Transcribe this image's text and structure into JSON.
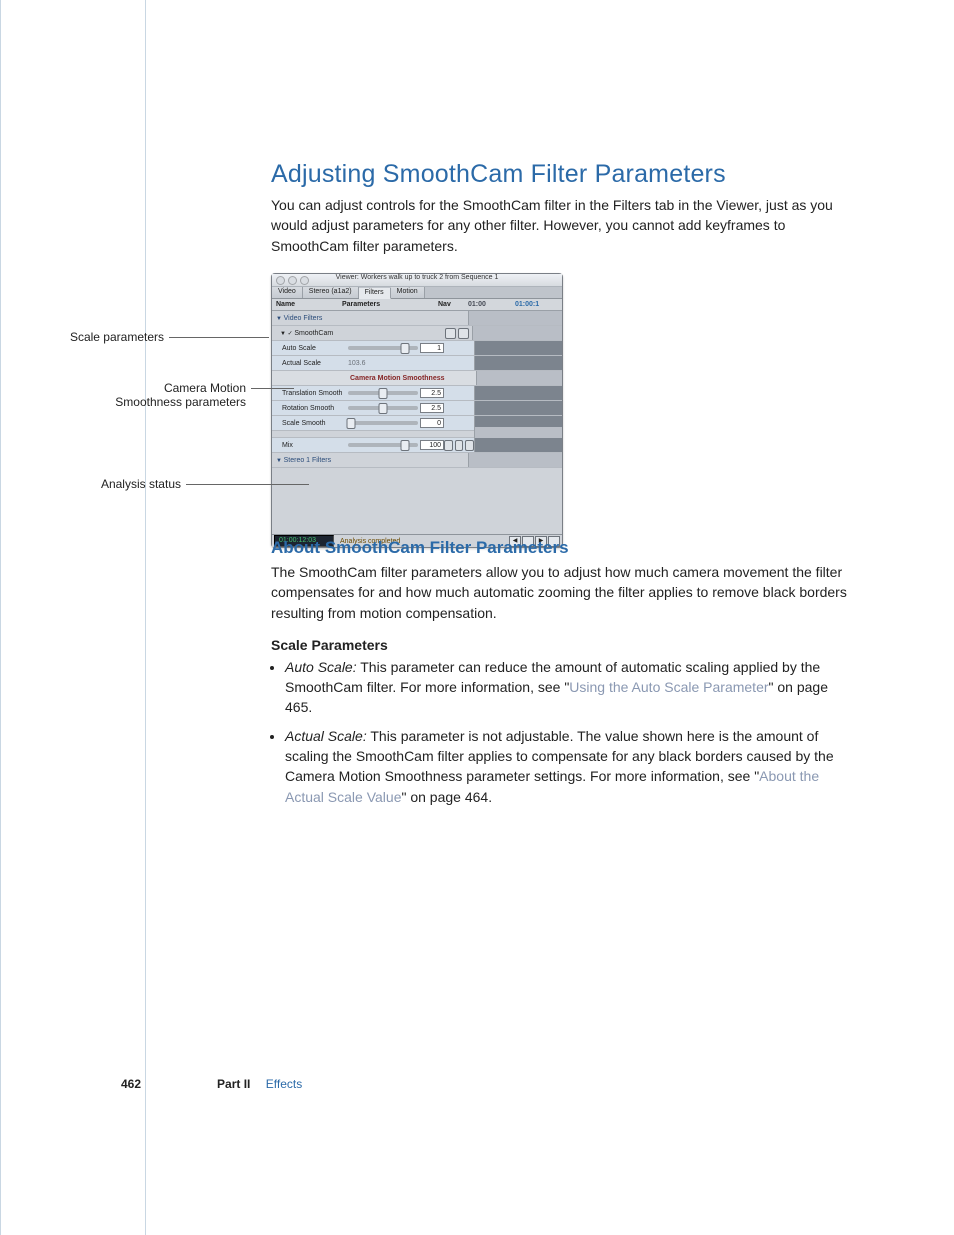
{
  "headings": {
    "h1": "Adjusting SmoothCam Filter Parameters",
    "h2": "About SmoothCam Filter Parameters",
    "h3": "Scale Parameters"
  },
  "paras": {
    "intro": "You can adjust controls for the SmoothCam filter in the Filters tab in the Viewer, just as you would adjust parameters for any other filter. However, you cannot add keyframes to SmoothCam filter parameters.",
    "about": "The SmoothCam filter parameters allow you to adjust how much camera movement the filter compensates for and how much automatic zooming the filter applies to remove black borders resulting from motion compensation."
  },
  "bullets": {
    "autoScale": {
      "termLabel": "Auto Scale:",
      "preLink": " This parameter can reduce the amount of automatic scaling applied by the SmoothCam filter. For more information, see \"",
      "link": "Using the Auto Scale Parameter",
      "postLink": "\" on page 465."
    },
    "actualScale": {
      "termLabel": "Actual Scale:",
      "preLink": " This parameter is not adjustable. The value shown here is the amount of scaling the SmoothCam filter applies to compensate for any black borders caused by the Camera Motion Smoothness parameter settings. For more information, see \"",
      "link": "About the Actual Scale Value",
      "postLink": "\" on page 464."
    }
  },
  "callouts": {
    "scale": "Scale parameters",
    "camera_l1": "Camera Motion",
    "camera_l2": "Smoothness parameters",
    "analysis": "Analysis status"
  },
  "viewer": {
    "title": "Viewer: Workers walk up to truck 2 from Sequence 1",
    "tabs": [
      "Video",
      "Stereo (a1a2)",
      "Filters",
      "Motion"
    ],
    "activeTab": 2,
    "columns": {
      "name": "Name",
      "parameters": "Parameters",
      "nav": "Nav",
      "t1": "01:00",
      "t2": "01:00:1"
    },
    "rows": {
      "videoFilters": "Video Filters",
      "smoothcam": "SmoothCam",
      "autoScale": {
        "label": "Auto Scale",
        "value": "1"
      },
      "actualScale": {
        "label": "Actual Scale",
        "value": "103.6"
      },
      "cmsHeading": "Camera Motion Smoothness",
      "translation": {
        "label": "Translation Smooth",
        "value": "2.5"
      },
      "rotation": {
        "label": "Rotation Smooth",
        "value": "2.5"
      },
      "scale": {
        "label": "Scale Smooth",
        "value": "0"
      },
      "mix": {
        "label": "Mix",
        "value": "100"
      },
      "stereoFilters": "Stereo 1 Filters"
    },
    "status": {
      "tc": "01:00:12:03",
      "msg": "Analysis completed"
    }
  },
  "footer": {
    "pagenum": "462",
    "part": "Part II",
    "section": "Effects"
  }
}
